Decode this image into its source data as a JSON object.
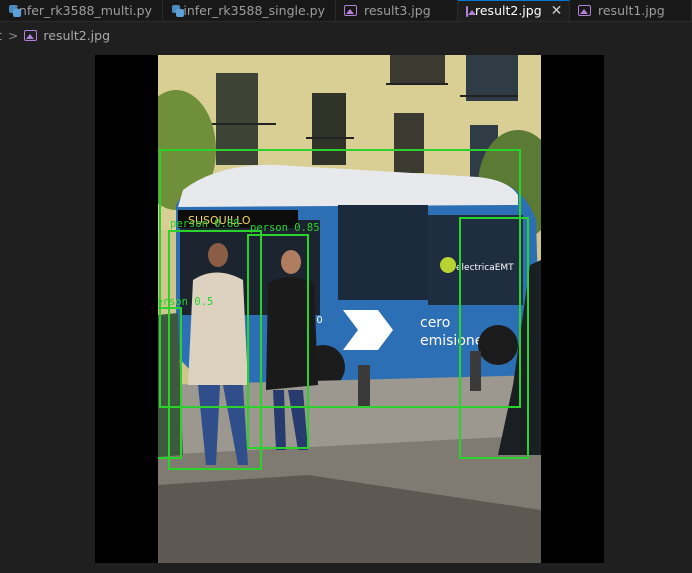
{
  "tabs": [
    {
      "label": "infer_rk3588_multi.py",
      "icon": "python-file-icon",
      "active": false
    },
    {
      "label": "infer_rk3588_single.py",
      "icon": "python-file-icon",
      "active": false
    },
    {
      "label": "result3.jpg",
      "icon": "image-file-icon",
      "active": false
    },
    {
      "label": "result2.jpg",
      "icon": "image-file-icon",
      "active": true,
      "close": "✕"
    },
    {
      "label": "result1.jpg",
      "icon": "image-file-icon",
      "active": false
    }
  ],
  "breadcrumb": {
    "parent": "t",
    "separator": ">",
    "file": "result2.jpg"
  },
  "detections": {
    "labels": [
      "person 0.88",
      "person 0.85",
      "person 0.5"
    ],
    "box_color": "#2bd22b"
  },
  "photo_text": {
    "bus_sign": "SUSQUILLO",
    "bus_logo": "electricaEMT",
    "bus_slogan_1": "cero",
    "bus_slogan_2": "emisiones",
    "bus_number": "10"
  }
}
